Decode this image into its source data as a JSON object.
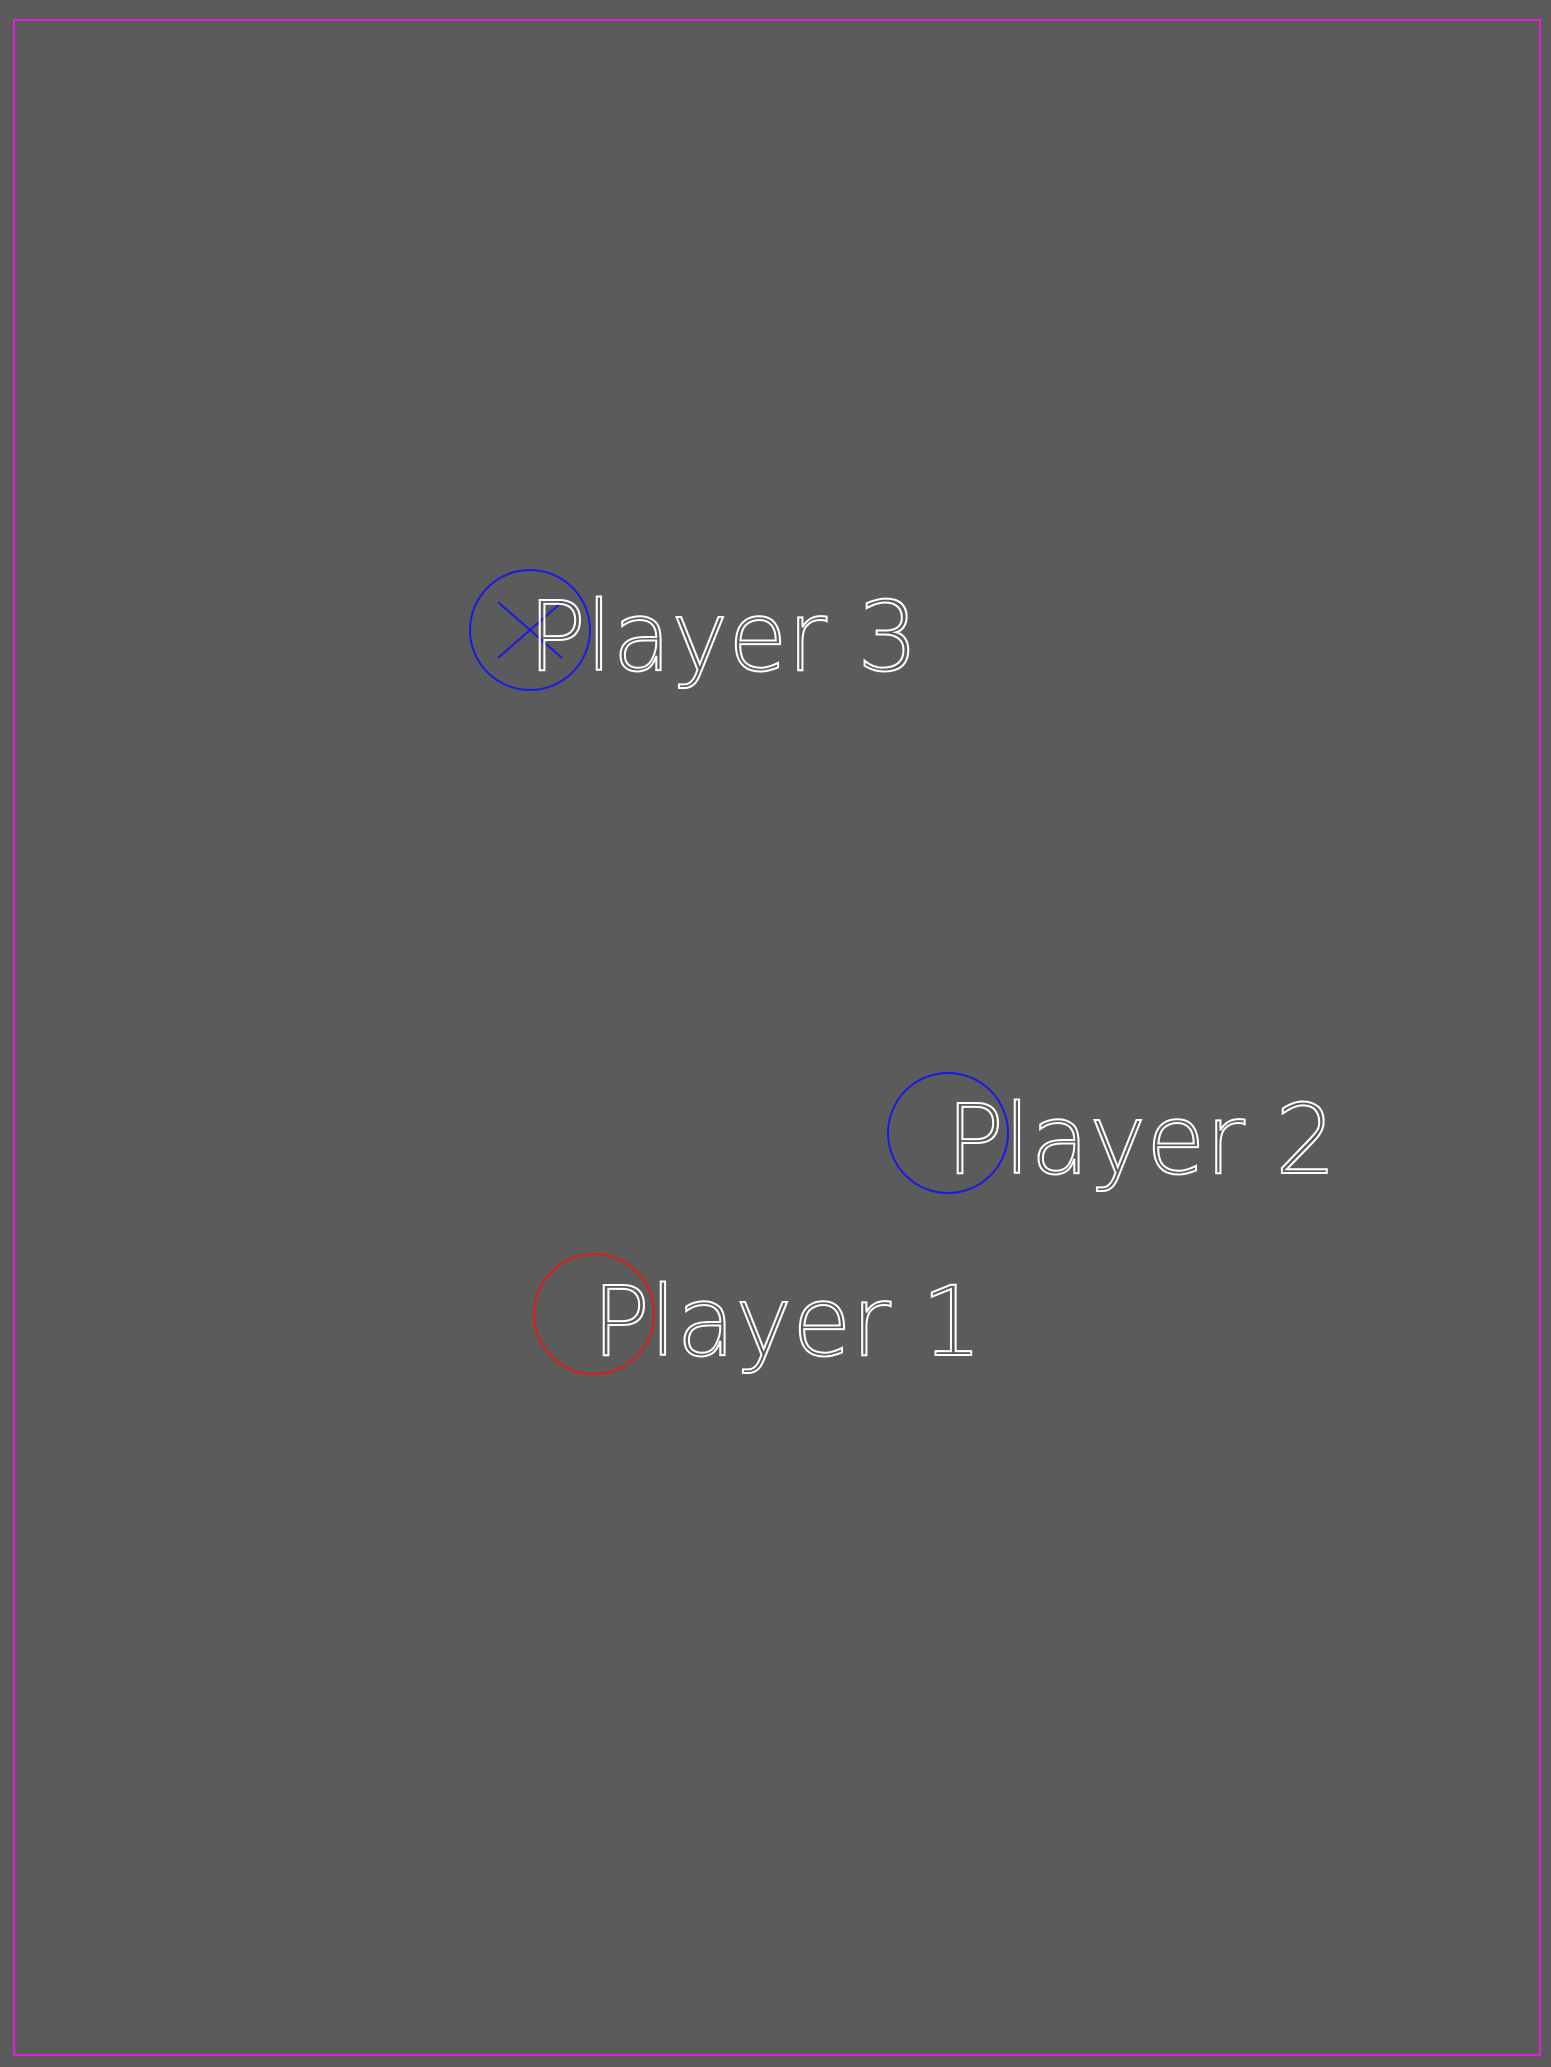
{
  "scene": {
    "background_color": "#5b5b5b",
    "border_color": "#e020e0"
  },
  "players": [
    {
      "id": "p3",
      "label": "Player 3",
      "ring_color": "#1a1ae6",
      "has_cross_marker": true
    },
    {
      "id": "p2",
      "label": "Player 2",
      "ring_color": "#1a1ae6",
      "has_cross_marker": false
    },
    {
      "id": "p1",
      "label": "Player 1",
      "ring_color": "#e01a1a",
      "has_cross_marker": false
    }
  ]
}
